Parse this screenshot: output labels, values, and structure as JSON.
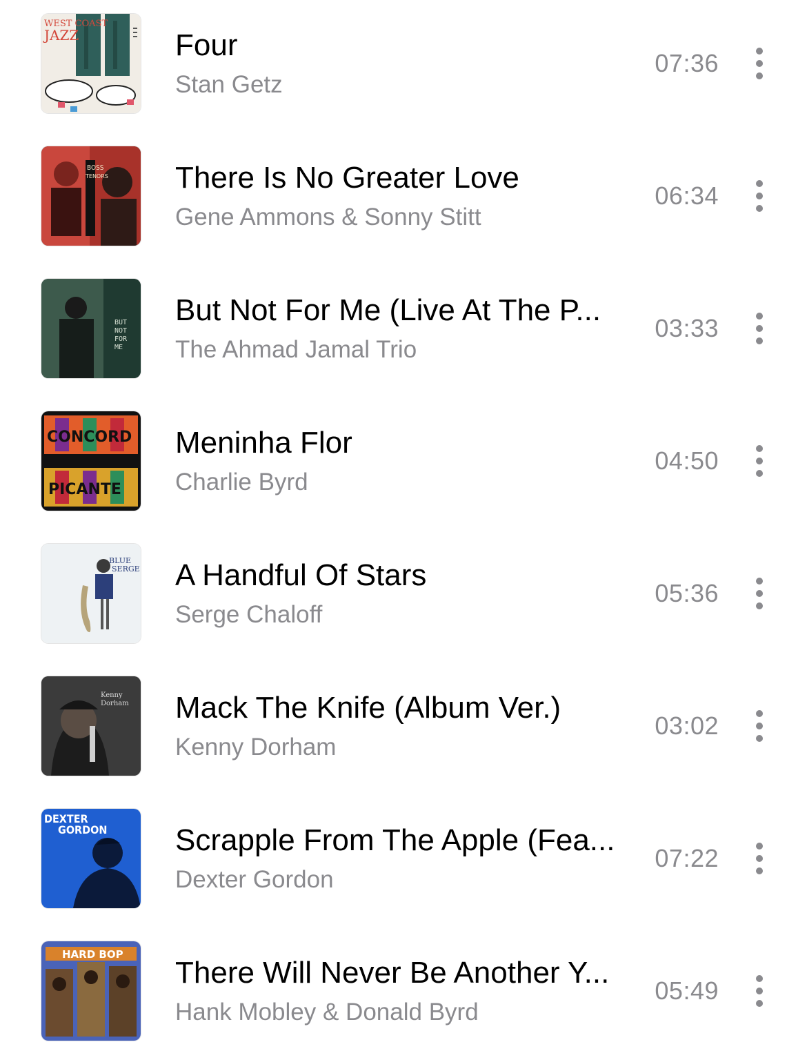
{
  "tracks": [
    {
      "title": "Four",
      "artist": "Stan Getz",
      "duration": "07:36",
      "cover": {
        "text_lines": [
          "WEST COAST",
          "JAZZ"
        ],
        "background": "#f1ede6",
        "accent": "#2f5f5a"
      }
    },
    {
      "title": "There Is No Greater Love",
      "artist": "Gene Ammons & Sonny Stitt",
      "duration": "06:34",
      "cover": {
        "text_lines": [
          "BOSS",
          "TENORS"
        ],
        "background": "#c9473d",
        "accent": "#1b1b1b"
      }
    },
    {
      "title": "But Not For Me (Live At The P...",
      "artist": "The Ahmad Jamal Trio",
      "duration": "03:33",
      "cover": {
        "text_lines": [
          "BUT",
          "NOT",
          "FOR",
          "ME"
        ],
        "background": "#234036",
        "accent": "#c7d1c3"
      }
    },
    {
      "title": "Meninha Flor",
      "artist": "Charlie Byrd",
      "duration": "04:50",
      "cover": {
        "text_lines": [
          "CONCORD",
          "PICANTE"
        ],
        "background": "#111111",
        "accent": "#e25d2a"
      }
    },
    {
      "title": "A Handful Of Stars",
      "artist": "Serge Chaloff",
      "duration": "05:36",
      "cover": {
        "text_lines": [
          "BLUE",
          "SERGE"
        ],
        "background": "#eef2f4",
        "accent": "#2c3f7a"
      }
    },
    {
      "title": "Mack The Knife (Album Ver.)",
      "artist": "Kenny Dorham",
      "duration": "03:02",
      "cover": {
        "text_lines": [
          "Kenny",
          "Dorham"
        ],
        "background": "#2d2d2d",
        "accent": "#dcdcdc"
      }
    },
    {
      "title": "Scrapple From The Apple (Fea...",
      "artist": "Dexter Gordon",
      "duration": "07:22",
      "cover": {
        "text_lines": [
          "DEXTER",
          "GORDON"
        ],
        "background": "#1f5fd1",
        "accent": "#0b1a3a"
      }
    },
    {
      "title": "There Will Never Be Another Y...",
      "artist": "Hank Mobley & Donald Byrd",
      "duration": "05:49",
      "cover": {
        "text_lines": [
          "HARD BOP"
        ],
        "background": "#4a63b8",
        "accent": "#d9822b"
      }
    }
  ],
  "icons": {
    "more": "vertical-ellipsis-icon"
  },
  "colors": {
    "title": "#000000",
    "secondary": "#8a8a8e",
    "background": "#ffffff"
  }
}
